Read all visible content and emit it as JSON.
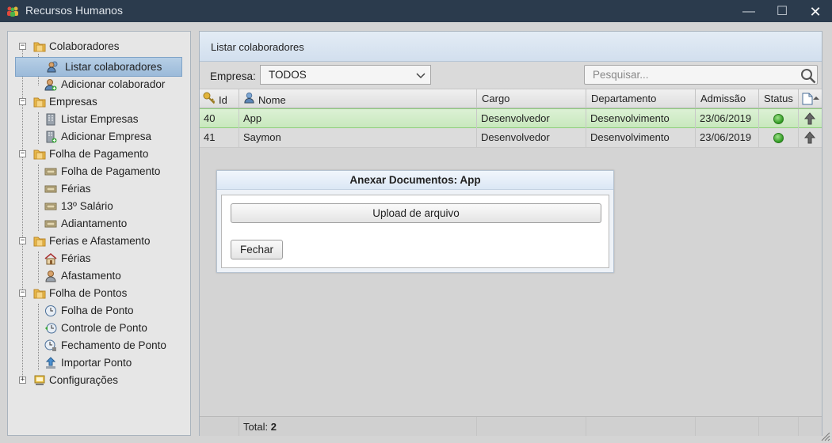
{
  "window": {
    "title": "Recursos Humanos",
    "minimize": "—",
    "maximize": "☐",
    "close": "✕"
  },
  "sidebar": {
    "groups": [
      {
        "label": "Colaboradores",
        "items": [
          "Listar colaboradores",
          "Adicionar colaborador"
        ]
      },
      {
        "label": "Empresas",
        "items": [
          "Listar Empresas",
          "Adicionar Empresa"
        ]
      },
      {
        "label": "Folha de Pagamento",
        "items": [
          "Folha de Pagamento",
          "Férias",
          "13º Salário",
          "Adiantamento"
        ]
      },
      {
        "label": "Ferias e Afastamento",
        "items": [
          "Férias",
          "Afastamento"
        ]
      },
      {
        "label": "Folha de Pontos",
        "items": [
          "Folha de Ponto",
          "Controle de Ponto",
          "Fechamento de Ponto",
          "Importar Ponto"
        ]
      },
      {
        "label": "Configurações",
        "items": []
      }
    ],
    "selected": "Listar colaboradores"
  },
  "panel": {
    "title": "Listar colaboradores"
  },
  "filter": {
    "empresa_label": "Empresa:",
    "empresa_value": "TODOS",
    "search_placeholder": "Pesquisar..."
  },
  "table": {
    "columns": [
      "Id",
      "Nome",
      "Cargo",
      "Departamento",
      "Admissão",
      "Status"
    ],
    "rows": [
      {
        "id": "40",
        "nome": "App",
        "cargo": "Desenvolvedor",
        "departamento": "Desenvolvimento",
        "admissao": "23/06/2019",
        "status": "active"
      },
      {
        "id": "41",
        "nome": "Saymon",
        "cargo": "Desenvolvedor",
        "departamento": "Desenvolvimento",
        "admissao": "23/06/2019",
        "status": "active"
      }
    ],
    "footer": {
      "total_label": "Total:",
      "total_value": "2"
    }
  },
  "dialog": {
    "title": "Anexar Documentos: App",
    "upload_label": "Upload de arquivo",
    "close_label": "Fechar"
  },
  "colors": {
    "titlebar": "#2b3b4d",
    "selected_row": "#c8e8bd",
    "status_active": "#2f9a22"
  }
}
